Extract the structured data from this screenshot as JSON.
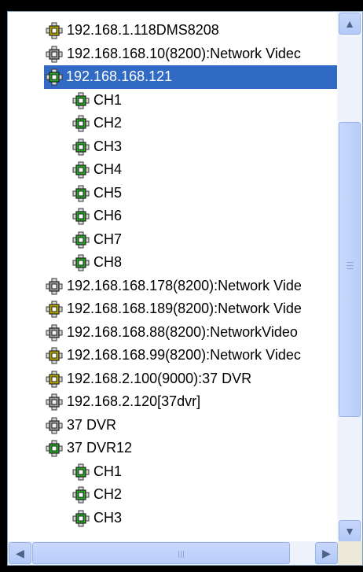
{
  "tree": {
    "items": [
      {
        "label": "192.168.1.118DMS8208",
        "level": 0,
        "icon": "device-icon-online-yellow",
        "selected": false
      },
      {
        "label": "192.168.168.10(8200):Network Videc",
        "level": 0,
        "icon": "device-icon-offline-gray",
        "selected": false
      },
      {
        "label": "192.168.168.121",
        "level": 0,
        "icon": "device-icon-online-green",
        "selected": true
      },
      {
        "label": "CH1",
        "level": 1,
        "icon": "channel-icon-green",
        "selected": false
      },
      {
        "label": "CH2",
        "level": 1,
        "icon": "channel-icon-green",
        "selected": false
      },
      {
        "label": "CH3",
        "level": 1,
        "icon": "channel-icon-green",
        "selected": false
      },
      {
        "label": "CH4",
        "level": 1,
        "icon": "channel-icon-green",
        "selected": false
      },
      {
        "label": "CH5",
        "level": 1,
        "icon": "channel-icon-green",
        "selected": false
      },
      {
        "label": "CH6",
        "level": 1,
        "icon": "channel-icon-green",
        "selected": false
      },
      {
        "label": "CH7",
        "level": 1,
        "icon": "channel-icon-green",
        "selected": false
      },
      {
        "label": "CH8",
        "level": 1,
        "icon": "channel-icon-green",
        "selected": false
      },
      {
        "label": "192.168.168.178(8200):Network Vide",
        "level": 0,
        "icon": "device-icon-offline-gray",
        "selected": false
      },
      {
        "label": "192.168.168.189(8200):Network Vide",
        "level": 0,
        "icon": "device-icon-online-yellow",
        "selected": false
      },
      {
        "label": "192.168.168.88(8200):NetworkVideo",
        "level": 0,
        "icon": "device-icon-offline-gray",
        "selected": false
      },
      {
        "label": "192.168.168.99(8200):Network Videc",
        "level": 0,
        "icon": "device-icon-online-yellow",
        "selected": false
      },
      {
        "label": "192.168.2.100(9000):37 DVR",
        "level": 0,
        "icon": "device-icon-online-yellow",
        "selected": false
      },
      {
        "label": "192.168.2.120[37dvr]",
        "level": 0,
        "icon": "device-icon-offline-gray",
        "selected": false
      },
      {
        "label": "37 DVR",
        "level": 0,
        "icon": "device-icon-offline-gray",
        "selected": false
      },
      {
        "label": "37 DVR12",
        "level": 0,
        "icon": "device-icon-online-green",
        "selected": false
      },
      {
        "label": "CH1",
        "level": 1,
        "icon": "channel-icon-green",
        "selected": false
      },
      {
        "label": "CH2",
        "level": 1,
        "icon": "channel-icon-green",
        "selected": false
      },
      {
        "label": "CH3",
        "level": 1,
        "icon": "channel-icon-green",
        "selected": false
      }
    ]
  },
  "scrollbars": {
    "vertical": {
      "up_icon": "scroll-up-arrow-icon",
      "down_icon": "scroll-down-arrow-icon"
    },
    "horizontal": {
      "left_icon": "scroll-left-arrow-icon",
      "right_icon": "scroll-right-arrow-icon"
    }
  },
  "colors": {
    "selection": "#316ac5",
    "icon_green": "#22a822",
    "icon_yellow": "#b8a800",
    "icon_gray": "#9a9a9a"
  }
}
